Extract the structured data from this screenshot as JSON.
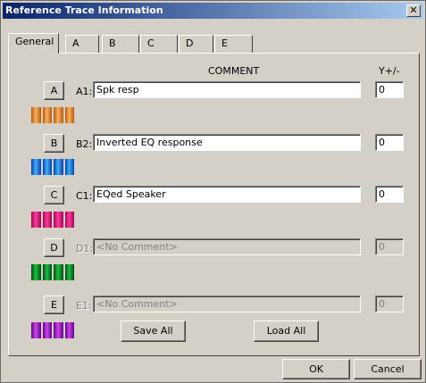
{
  "window": {
    "title": "Reference Trace Information",
    "close_glyph": "✕"
  },
  "tabs": [
    {
      "label": "General",
      "active": true
    },
    {
      "label": "A"
    },
    {
      "label": "B"
    },
    {
      "label": "C"
    },
    {
      "label": "D"
    },
    {
      "label": "E"
    }
  ],
  "headers": {
    "comment": "COMMENT",
    "y_offset": "Y+/-"
  },
  "traces": [
    {
      "button": "A",
      "label": "A1:",
      "comment": "Spk resp",
      "y": "0",
      "enabled": true,
      "color_dark": "#b85a08",
      "color_light": "#f8b060"
    },
    {
      "button": "B",
      "label": "B2:",
      "comment": "Inverted EQ response",
      "y": "0",
      "enabled": true,
      "color_dark": "#0a3ea8",
      "color_light": "#3ab0ff"
    },
    {
      "button": "C",
      "label": "C1:",
      "comment": "EQed Speaker",
      "y": "0",
      "enabled": true,
      "color_dark": "#a0084e",
      "color_light": "#ff3aa0"
    },
    {
      "button": "D",
      "label": "D1:",
      "comment": "<No Comment>",
      "y": "0",
      "enabled": false,
      "color_dark": "#044a10",
      "color_light": "#18c040"
    },
    {
      "button": "E",
      "label": "E1:",
      "comment": "<No Comment>",
      "y": "0",
      "enabled": false,
      "color_dark": "#5a0880",
      "color_light": "#d040f0"
    }
  ],
  "actions": {
    "save_all": "Save All",
    "load_all": "Load All",
    "ok": "OK",
    "cancel": "Cancel"
  }
}
